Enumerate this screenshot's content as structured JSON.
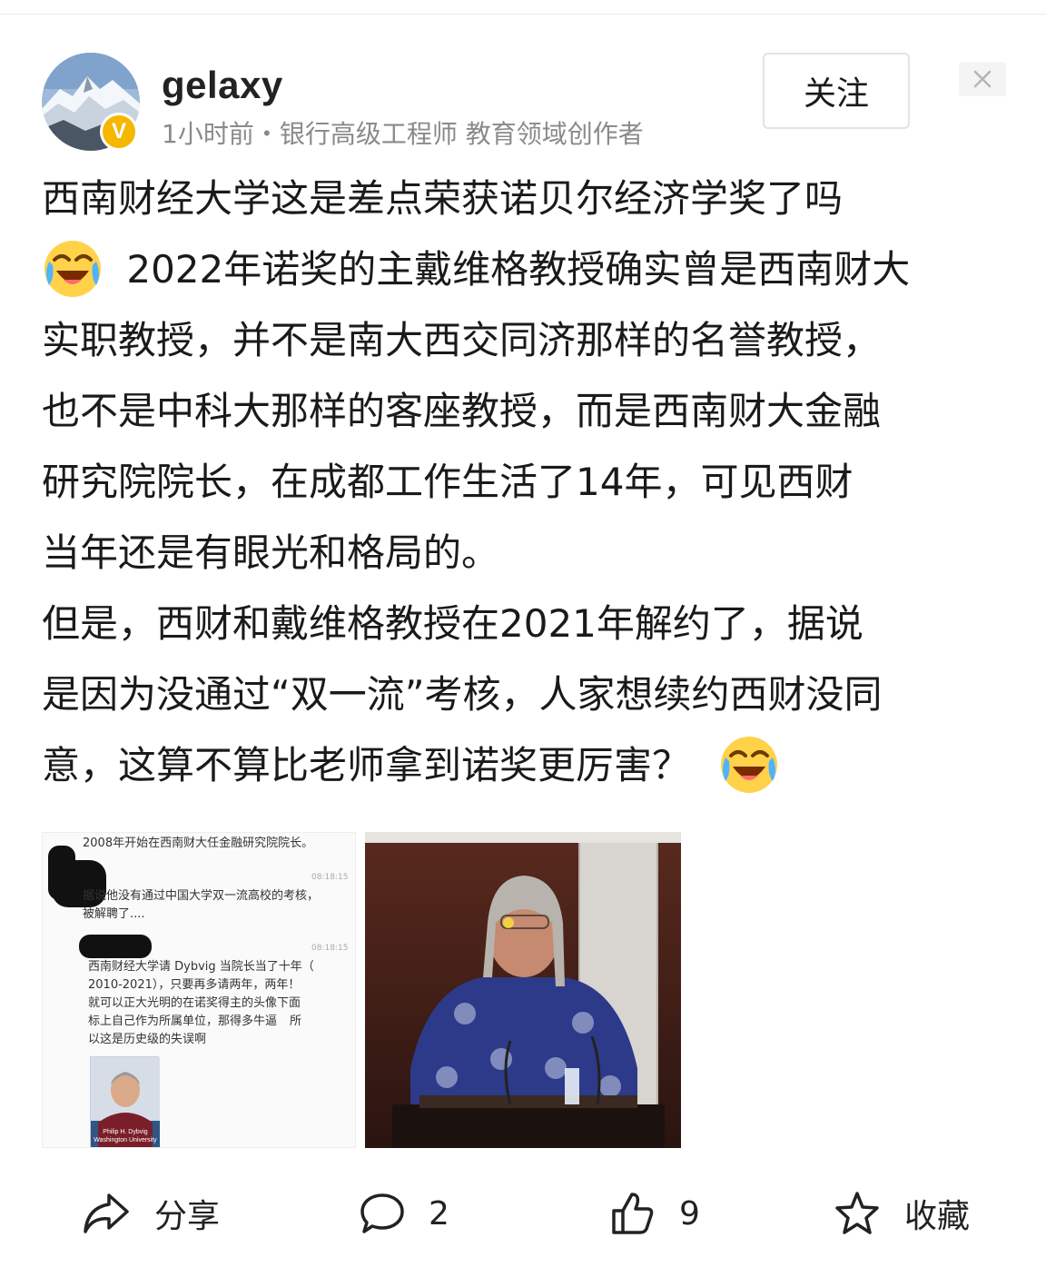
{
  "user": {
    "name": "gelaxy",
    "verified_badge": "V",
    "meta": "1小时前・银行高级工程师 教育领域创作者"
  },
  "header": {
    "follow_label": "关注",
    "close_icon": "close-icon"
  },
  "post": {
    "lines": [
      "西南财经大学这是差点荣获诺贝尔经济学奖了吗",
      "2022年诺奖的主戴维格教授确实曾是西南财大",
      "实职教授，并不是南大西交同济那样的名誉教授，",
      "也不是中科大那样的客座教授，而是西南财大金融",
      "研究院院长，在成都工作生活了14年，可见西财",
      "当年还是有眼光和格局的。",
      "但是，西财和戴维格教授在2021年解约了，据说",
      "是因为没通过“双一流”考核，人家想续约西财没同",
      "意，这算不算比老师拿到诺奖更厉害？"
    ],
    "emoji": "laughing-crying-emoji"
  },
  "images": {
    "left": {
      "lines": [
        "2008年开始在西南财大任金融研究院院长。",
        "据说他没有通过中国大学双一流高校的考核，",
        "被解聘了....",
        "西南财经大学请 Dybvig 当院长当了十年（",
        "2010-2021），只要再多请两年，两年！",
        "就可以正大光明的在诺奖得主的头像下面",
        "标上自己作为所属单位，那得多牛逼",
        "所",
        "以这是历史级的失误啊"
      ],
      "times": [
        "08:18:15",
        "08:18:15"
      ],
      "card_caption": [
        "Philip H. Dybvig",
        "Washington University"
      ]
    },
    "right": {
      "alt": "professor-at-podium-photo"
    }
  },
  "actions": {
    "share_label": "分享",
    "comment_count": "2",
    "like_count": "9",
    "favorite_label": "收藏"
  },
  "colors": {
    "badge": "#f5b700",
    "text": "#1a1a1a",
    "meta": "#8a8a8a"
  }
}
